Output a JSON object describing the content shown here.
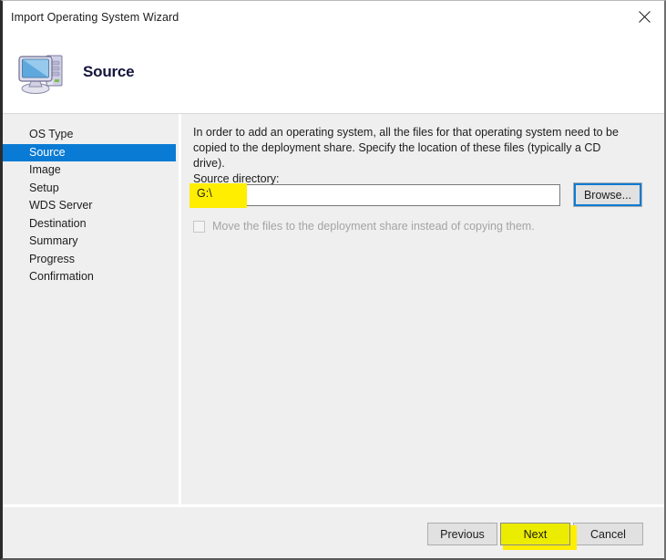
{
  "window": {
    "title": "Import Operating System Wizard",
    "close_icon": "close-icon"
  },
  "header": {
    "title": "Source",
    "icon": "computer-icon"
  },
  "sidebar": {
    "items": [
      {
        "label": "OS Type",
        "selected": false
      },
      {
        "label": "Source",
        "selected": true
      },
      {
        "label": "Image",
        "selected": false
      },
      {
        "label": "Setup",
        "selected": false
      },
      {
        "label": "WDS Server",
        "selected": false
      },
      {
        "label": "Destination",
        "selected": false
      },
      {
        "label": "Summary",
        "selected": false
      },
      {
        "label": "Progress",
        "selected": false
      },
      {
        "label": "Confirmation",
        "selected": false
      }
    ],
    "selected_color": "#0a7bd4"
  },
  "main": {
    "description": "In order to add an operating system, all the files for that operating system need to be copied to the deployment share.  Specify the location of these files (typically a CD drive).",
    "source_directory_label": "Source directory:",
    "source_directory_value": "G:\\",
    "source_directory_placeholder": "",
    "browse_label": "Browse...",
    "checkbox_label": "Move the files to the deployment share instead of copying them.",
    "checkbox_checked": false,
    "checkbox_disabled": true
  },
  "footer": {
    "previous_label": "Previous",
    "next_label": "Next",
    "cancel_label": "Cancel"
  },
  "annotations": {
    "highlight_color": "#ffee00",
    "source_field_highlighted": true,
    "next_button_highlighted": true
  }
}
